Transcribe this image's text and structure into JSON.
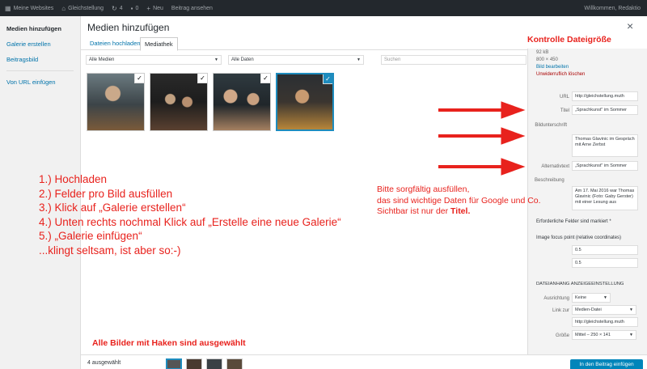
{
  "adminbar": {
    "site": "Meine Websites",
    "site2": "Gleichstellung",
    "updates": "4",
    "comments": "0",
    "new": "Neu",
    "view": "Beitrag ansehen",
    "greeting": "Willkommen, Redaktio"
  },
  "modal": {
    "title": "Medien hinzufügen",
    "close": "×"
  },
  "left_menu": {
    "items": [
      "Medien hinzufügen",
      "Galerie erstellen",
      "Beitragsbild",
      "Von URL einfügen"
    ]
  },
  "tabs": [
    "Dateien hochladen",
    "Mediathek"
  ],
  "filters": {
    "media": "Alle Medien",
    "dates": "Alle Daten",
    "search_placeholder": "Suchen"
  },
  "details": {
    "size": "92 kB",
    "dims": "800 × 450",
    "edit": "Bild bearbeiten",
    "delete": "Unwiderruflich löschen",
    "url_label": "URL",
    "url_value": "http://gleichstellung.muth",
    "title_label": "Titel",
    "title_value": "„Sprachkunst\" im Sommer",
    "caption_label": "Bildunterschrift",
    "caption_value": "Thomas Glavinic im Gespräch mit Arne Zerbst",
    "alt_label": "Alternativtext",
    "alt_value": "„Sprachkunst\" im Sommer",
    "desc_label": "Beschreibung",
    "desc_value": "Am 17. Mai 2016 war Thomas Glavinic (Foto: Gaby Gerster) mit einer Lesung aus",
    "required": "Erforderliche Felder sind markiert *",
    "focus_label": "Image focus point (relative coordinates)",
    "focus_x": "0.5",
    "focus_y": "0.5",
    "settings_heading": "DATEIANHANG ANZEIGEEINSTELLUNG",
    "align_label": "Ausrichtung",
    "align_value": "Keine",
    "link_label": "Link zur",
    "link_value": "Medien-Datei",
    "link_url": "http://gleichstellung.muth",
    "size_label": "Größe",
    "size_value": "Mittel – 250 × 141"
  },
  "footer": {
    "selected_count": "4 ausgewählt",
    "insert_button": "In den Beitrag einfügen"
  },
  "annotations": {
    "title": "Kontrolle Dateigröße",
    "steps": [
      "1.) Hochladen",
      "2.) Felder pro Bild ausfüllen",
      "3.) Klick auf „Galerie erstellen“",
      "4.) Unten rechts nochmal Klick auf „Erstelle eine neue Galerie“",
      "5.) „Galerie einfügen“",
      "...klingt seltsam, ist aber so:-)"
    ],
    "note_line1": "Bitte sorgfältig ausfüllen,",
    "note_line2": "das sind wichtige Daten für Google und Co.",
    "note_line3": "Sichtbar ist nur der",
    "note_bold": "Titel.",
    "selected_note": "Alle Bilder mit Haken sind ausgewählt"
  },
  "colors": {
    "annotation_red": "#e8221d",
    "wp_blue": "#0073aa",
    "selection_blue": "#1e8cbe",
    "adminbar": "#23282d"
  }
}
